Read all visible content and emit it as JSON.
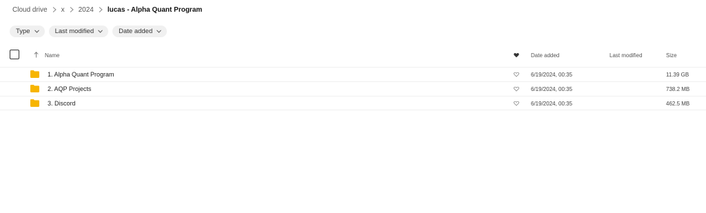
{
  "breadcrumb": {
    "items": [
      "Cloud drive",
      "x",
      "2024"
    ],
    "current": "lucas - Alpha Quant Program"
  },
  "filters": [
    {
      "label": "Type"
    },
    {
      "label": "Last modified"
    },
    {
      "label": "Date added"
    }
  ],
  "table": {
    "headers": {
      "name": "Name",
      "date_added": "Date added",
      "last_modified": "Last modified",
      "size": "Size"
    },
    "rows": [
      {
        "name": "1. Alpha Quant Program",
        "date_added": "6/19/2024, 00:35",
        "last_modified": "",
        "size": "11.39 GB",
        "icon": "folder-icon"
      },
      {
        "name": "2. AQP Projects",
        "date_added": "6/19/2024, 00:35",
        "last_modified": "",
        "size": "738.2 MB",
        "icon": "folder-icon"
      },
      {
        "name": "3. Discord",
        "date_added": "6/19/2024, 00:35",
        "last_modified": "",
        "size": "462.5 MB",
        "icon": "folder-icon"
      }
    ]
  },
  "colors": {
    "folder": "#f7b500",
    "chip_bg": "#f0f0f0",
    "divider": "#f0f0f0"
  }
}
